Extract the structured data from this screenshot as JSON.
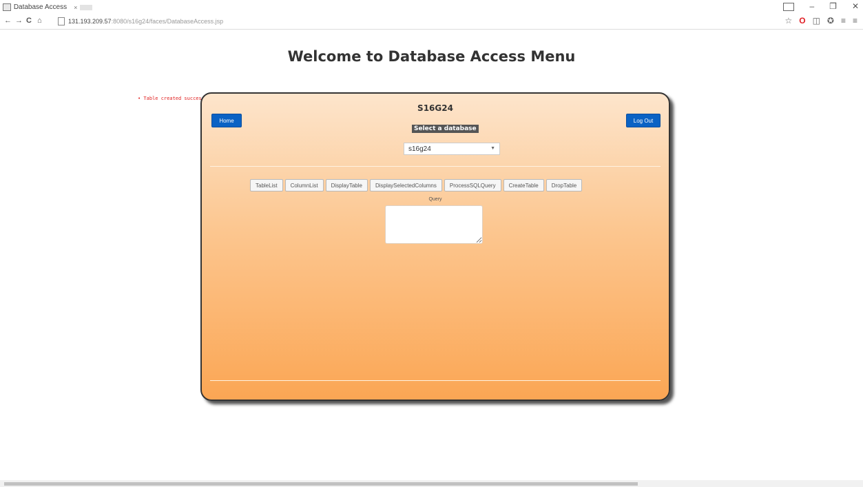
{
  "browser": {
    "tab_title": "Database Access",
    "tab_close": "×",
    "url_host": "131.193.209.57",
    "url_path": ":8080/s16g24/faces/DatabaseAccess.jsp",
    "nav_back": "←",
    "nav_forward": "→",
    "nav_reload": "C",
    "nav_home": "⌂",
    "win_minimize": "–",
    "win_restore": "❐",
    "win_close": "✕",
    "ext_star": "☆",
    "ext_opera": "O",
    "ext_other1": "◫",
    "ext_other2": "✪",
    "ext_other3": "≡",
    "ext_menu": "≡"
  },
  "page": {
    "heading": "Welcome to Database Access Menu",
    "status_message": "• Table  created successfully in your database"
  },
  "panel": {
    "user": "S16G24",
    "home_label": "Home",
    "logout_label": "Log Out",
    "select_label": "Select a database",
    "selected_db": "s16g24",
    "actions": [
      "TableList",
      "ColumnList",
      "DisplayTable",
      "DisplaySelectedColumns",
      "ProcessSQLQuery",
      "CreateTable",
      "DropTable"
    ],
    "query_label": "Query",
    "query_value": ""
  },
  "colors": {
    "accent_blue": "#0a62c4",
    "panel_top": "#fde5cc",
    "panel_bottom": "#fba654",
    "status_red": "#e02020"
  }
}
